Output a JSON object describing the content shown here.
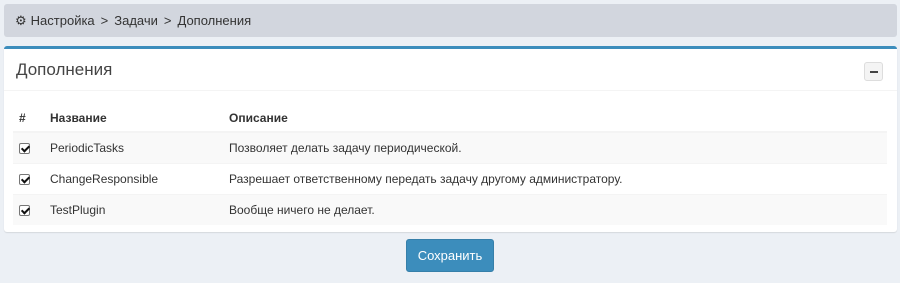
{
  "breadcrumb": {
    "icon": "gear-icon",
    "items": [
      "Настройка",
      "Задачи",
      "Дополнения"
    ],
    "separator": ">"
  },
  "panel": {
    "title": "Дополнения",
    "collapse_icon": "minus-icon",
    "accent_color": "#3c8dbc"
  },
  "table": {
    "headers": [
      "#",
      "Название",
      "Описание"
    ],
    "rows": [
      {
        "checked": true,
        "name": "PeriodicTasks",
        "description": "Позволяет делать задачу периодической."
      },
      {
        "checked": true,
        "name": "ChangeResponsible",
        "description": "Разрешает ответственному передать задачу другому администратору."
      },
      {
        "checked": true,
        "name": "TestPlugin",
        "description": "Вообще ничего не делает."
      }
    ]
  },
  "actions": {
    "save_label": "Сохранить"
  }
}
